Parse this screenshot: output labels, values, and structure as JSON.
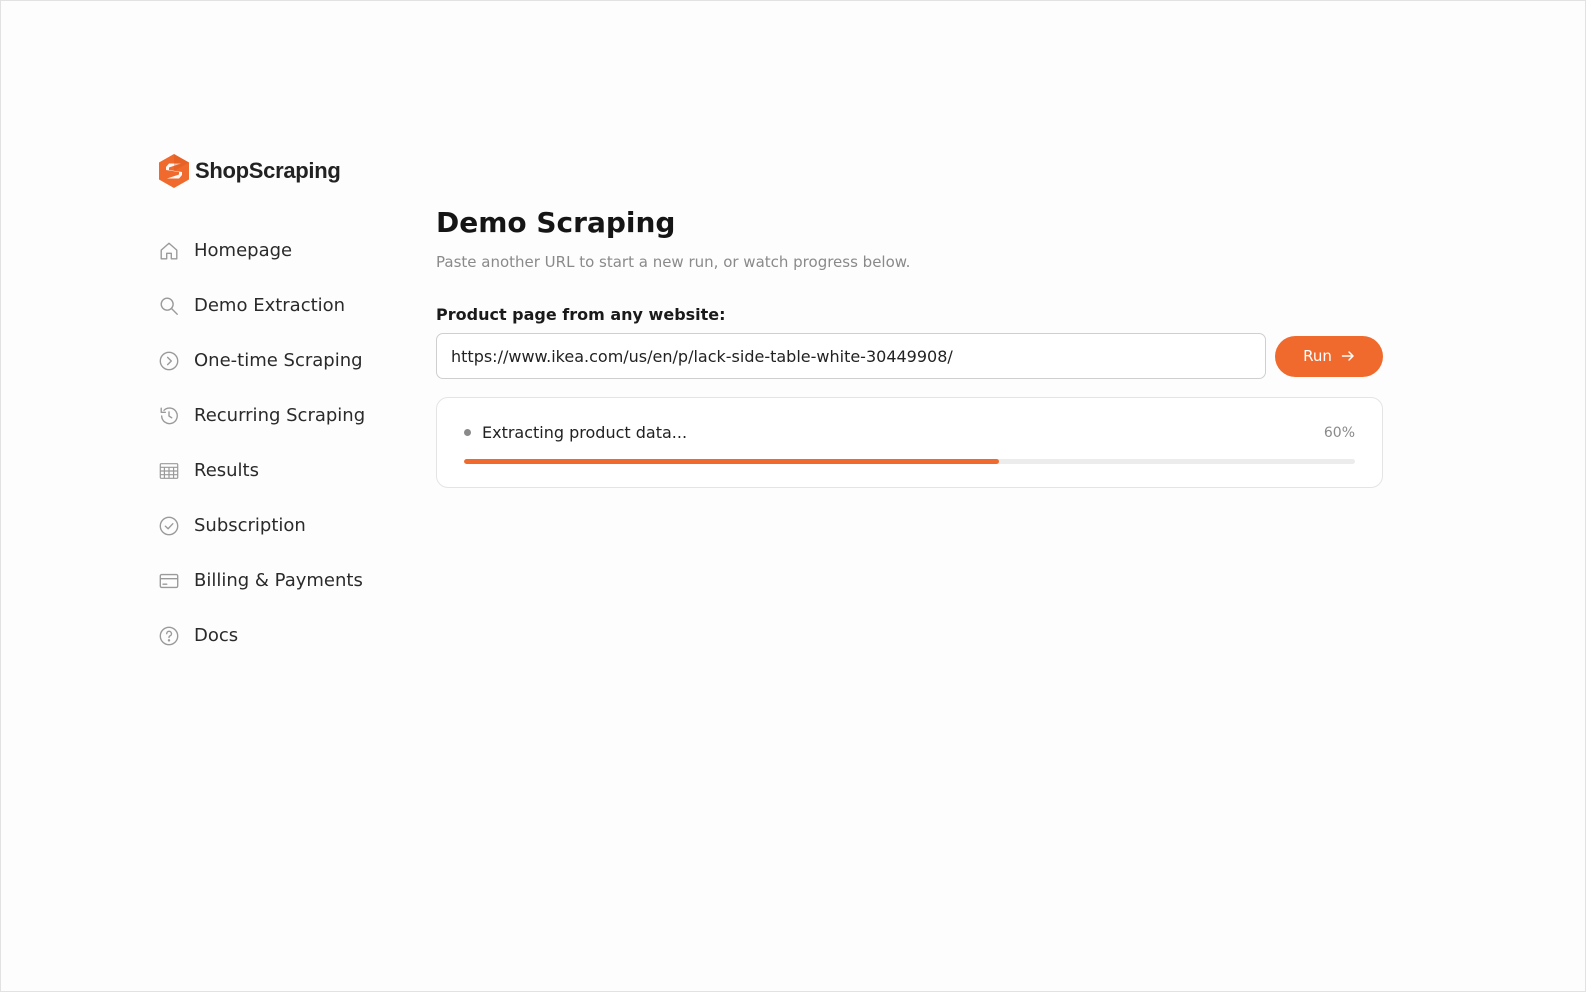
{
  "brand": {
    "name": "ShopScraping",
    "accent_color": "#ef6a2c"
  },
  "sidebar": {
    "items": [
      {
        "label": "Homepage",
        "icon": "home-icon"
      },
      {
        "label": "Demo Extraction",
        "icon": "search-icon"
      },
      {
        "label": "One-time Scraping",
        "icon": "chevron-circle-icon"
      },
      {
        "label": "Recurring Scraping",
        "icon": "history-icon"
      },
      {
        "label": "Results",
        "icon": "table-icon"
      },
      {
        "label": "Subscription",
        "icon": "check-circle-icon"
      },
      {
        "label": "Billing & Payments",
        "icon": "credit-card-icon"
      },
      {
        "label": "Docs",
        "icon": "help-circle-icon"
      }
    ]
  },
  "main": {
    "title": "Demo Scraping",
    "subtitle": "Paste another URL to start a new run, or watch progress below.",
    "field_label": "Product page from any website:",
    "url_value": "https://www.ikea.com/us/en/p/lack-side-table-white-30449908/",
    "run_label": "Run",
    "progress": {
      "status": "Extracting product data...",
      "percent_label": "60%",
      "value": 0.6
    }
  }
}
